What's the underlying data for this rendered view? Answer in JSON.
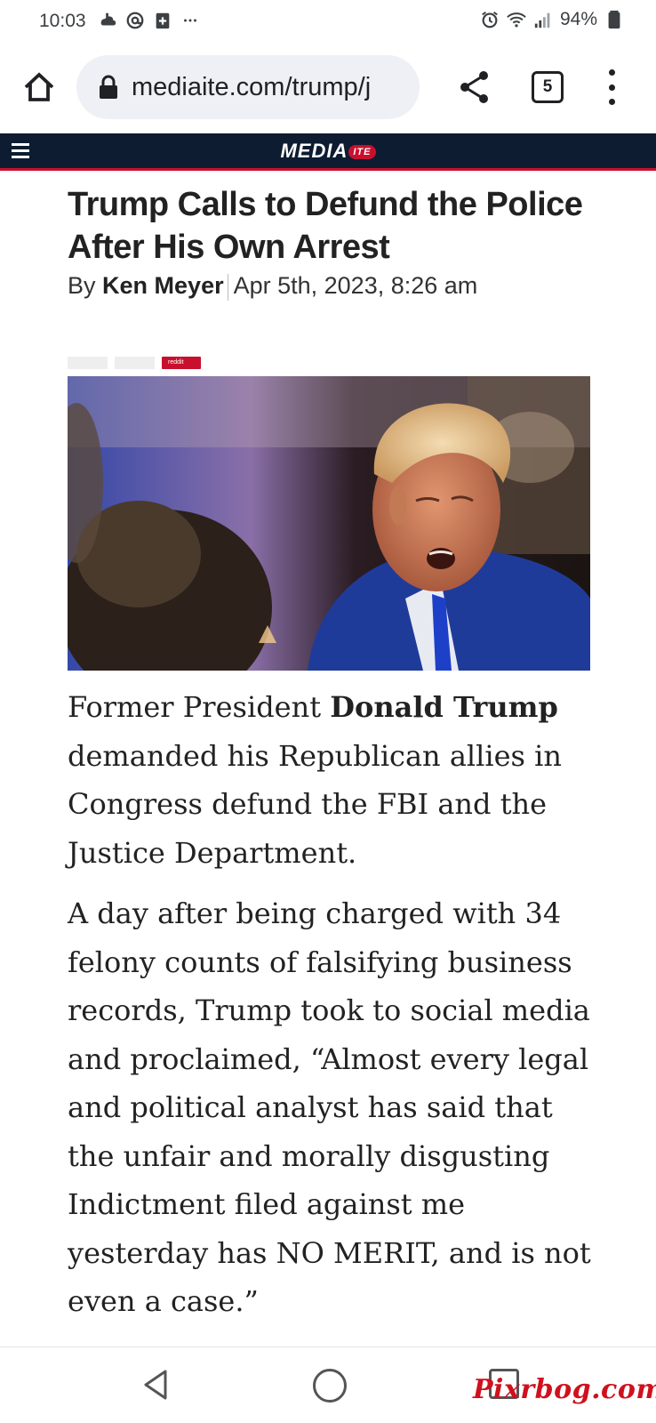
{
  "status_bar": {
    "time": "10:03",
    "battery": "94%",
    "left_icons": [
      "cloud-app-icon",
      "at-sign-icon",
      "health-app-icon",
      "more-notifications-icon"
    ],
    "right_icons": [
      "alarm-icon",
      "wifi-icon",
      "signal-icon",
      "battery-icon"
    ]
  },
  "browser": {
    "url": "mediaite.com/trump/j",
    "tab_count": "5"
  },
  "site": {
    "logo_main": "MEDIA",
    "logo_badge": "ITE"
  },
  "article": {
    "title": "Trump Calls to Defund the Police After His Own Arrest",
    "byline_prefix": "By",
    "author": "Ken Meyer",
    "date": "Apr 5th, 2023, 8:26 am",
    "share_reddit_label": "reddit",
    "p1_start": "Former President",
    "p1_name": "Donald Trump",
    "p1_rest": "demanded his Republican allies in Congress defund the FBI and the Justice Department.",
    "p2": "A day after being charged with 34 felony counts of falsifying business records, Trump took to social media and proclaimed, “Almost every legal and political analyst has said that the unfair and morally disgusting Indictment filed against me yesterday has NO MERIT, and is not even a case.”"
  },
  "watermark": "Pixrbog.com",
  "colors": {
    "header_bg": "#0d1c30",
    "brand_red": "#c8102e",
    "url_pill_bg": "#eef0f5",
    "watermark": "#d0101d"
  }
}
